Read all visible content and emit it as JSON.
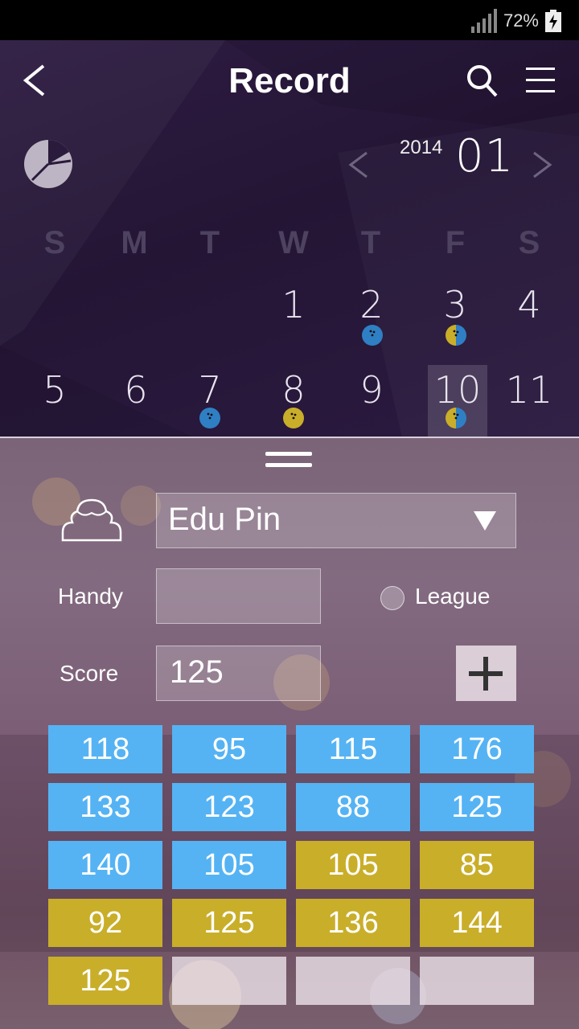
{
  "status_bar": {
    "battery_text": "72%"
  },
  "header": {
    "title": "Record"
  },
  "calendar": {
    "year": "2014",
    "month": "01",
    "weekdays": [
      "S",
      "M",
      "T",
      "W",
      "T",
      "F",
      "S"
    ],
    "days": [
      "1",
      "2",
      "3",
      "4",
      "5",
      "6",
      "7",
      "8",
      "9",
      "10",
      "11"
    ],
    "selected_day": "10"
  },
  "form": {
    "bowler": "Edu Pin",
    "handy_label": "Handy",
    "handy_value": "",
    "league_label": "League",
    "score_label": "Score",
    "score_value": "125"
  },
  "scores": [
    {
      "value": "118",
      "color": "blue"
    },
    {
      "value": "95",
      "color": "blue"
    },
    {
      "value": "115",
      "color": "blue"
    },
    {
      "value": "176",
      "color": "blue"
    },
    {
      "value": "133",
      "color": "blue"
    },
    {
      "value": "123",
      "color": "blue"
    },
    {
      "value": "88",
      "color": "blue"
    },
    {
      "value": "125",
      "color": "blue"
    },
    {
      "value": "140",
      "color": "blue"
    },
    {
      "value": "105",
      "color": "blue"
    },
    {
      "value": "105",
      "color": "gold"
    },
    {
      "value": "85",
      "color": "gold"
    },
    {
      "value": "92",
      "color": "gold"
    },
    {
      "value": "125",
      "color": "gold"
    },
    {
      "value": "136",
      "color": "gold"
    },
    {
      "value": "144",
      "color": "gold"
    },
    {
      "value": "125",
      "color": "gold"
    },
    {
      "value": "",
      "color": "empty"
    },
    {
      "value": "",
      "color": "empty"
    },
    {
      "value": "",
      "color": "empty"
    }
  ],
  "colors": {
    "blue": "#55b3f3",
    "gold": "#c9ae2a",
    "ball_blue": "#2f7fc4",
    "ball_gold": "#c9ae2a"
  }
}
